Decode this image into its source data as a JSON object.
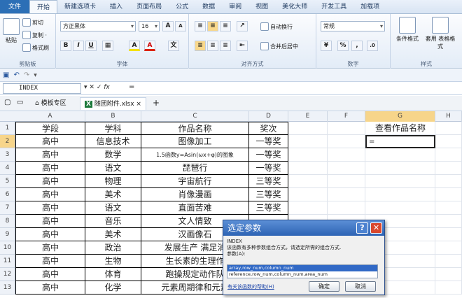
{
  "ribbon_tabs": [
    "文件",
    "开始",
    "新建选项卡",
    "插入",
    "页面布局",
    "公式",
    "数据",
    "审阅",
    "视图",
    "美化大师",
    "开发工具",
    "加载项"
  ],
  "clipboard": {
    "paste": "粘贴",
    "cut": "剪切",
    "copy": "复制 ·",
    "painter": "格式刷",
    "label": "剪贴板"
  },
  "font": {
    "name": "方正黑体",
    "size": "16",
    "grow": "A",
    "shrink": "A",
    "bold": "B",
    "italic": "I",
    "underline": "U",
    "fill": "A",
    "color": "A",
    "label": "字体"
  },
  "alignment": {
    "wrap": "自动换行",
    "merge": "合并后居中",
    "label": "对齐方式"
  },
  "number": {
    "format": "常规",
    "percent": "%",
    "comma": ",",
    "label": "数字"
  },
  "styles": {
    "conditional": "条件格式",
    "table": "套用 表格格式",
    "label": "样式"
  },
  "formula_bar": {
    "name_box": "INDEX",
    "formula": "="
  },
  "doc_tabs": {
    "template": "模板专区",
    "file": "随团附件.xlsx"
  },
  "columns": [
    "A",
    "B",
    "C",
    "D",
    "E",
    "F",
    "G",
    "H"
  ],
  "rows": [
    "1",
    "2",
    "3",
    "4",
    "5",
    "6",
    "7",
    "8",
    "9",
    "10",
    "11",
    "12",
    "13"
  ],
  "table": [
    [
      "学段",
      "学科",
      "作品名称",
      "奖次"
    ],
    [
      "高中",
      "信息技术",
      "图像加工",
      "一等奖"
    ],
    [
      "高中",
      "数学",
      "1.5函数y=Asin(ωx+φ)的图象",
      "一等奖"
    ],
    [
      "高中",
      "语文",
      "琵琶行",
      "一等奖"
    ],
    [
      "高中",
      "物理",
      "宇宙航行",
      "三等奖"
    ],
    [
      "高中",
      "美术",
      "肖像漫画",
      "三等奖"
    ],
    [
      "高中",
      "语文",
      "直面苦难",
      "三等奖"
    ],
    [
      "高中",
      "音乐",
      "文人情致",
      ""
    ],
    [
      "高中",
      "美术",
      "汉画像石",
      ""
    ],
    [
      "高中",
      "政治",
      "发展生产 满足消",
      ""
    ],
    [
      "高中",
      "生物",
      "生长素的生理作",
      ""
    ],
    [
      "高中",
      "体育",
      "跑操规定动作队",
      ""
    ],
    [
      "高中",
      "化学",
      "元素周期律和元素",
      ""
    ]
  ],
  "lookup": {
    "title": "查看作品名称",
    "input": "="
  },
  "dialog": {
    "title": "选定参数",
    "help": "?",
    "close": "✕",
    "func": "INDEX",
    "desc": "该函数有多种参数组合方式，请选定所需的组合方式.",
    "param_label": "参数(A):",
    "options": [
      "array,row_num,column_num",
      "reference,row_num,column_num,area_num"
    ],
    "link": "有关该函数的帮助(H)",
    "ok": "确定",
    "cancel": "取消"
  },
  "colors": {
    "selected_header": "#f7d58a",
    "title_bar": "#2d63b4",
    "close_button": "#d9482e"
  }
}
